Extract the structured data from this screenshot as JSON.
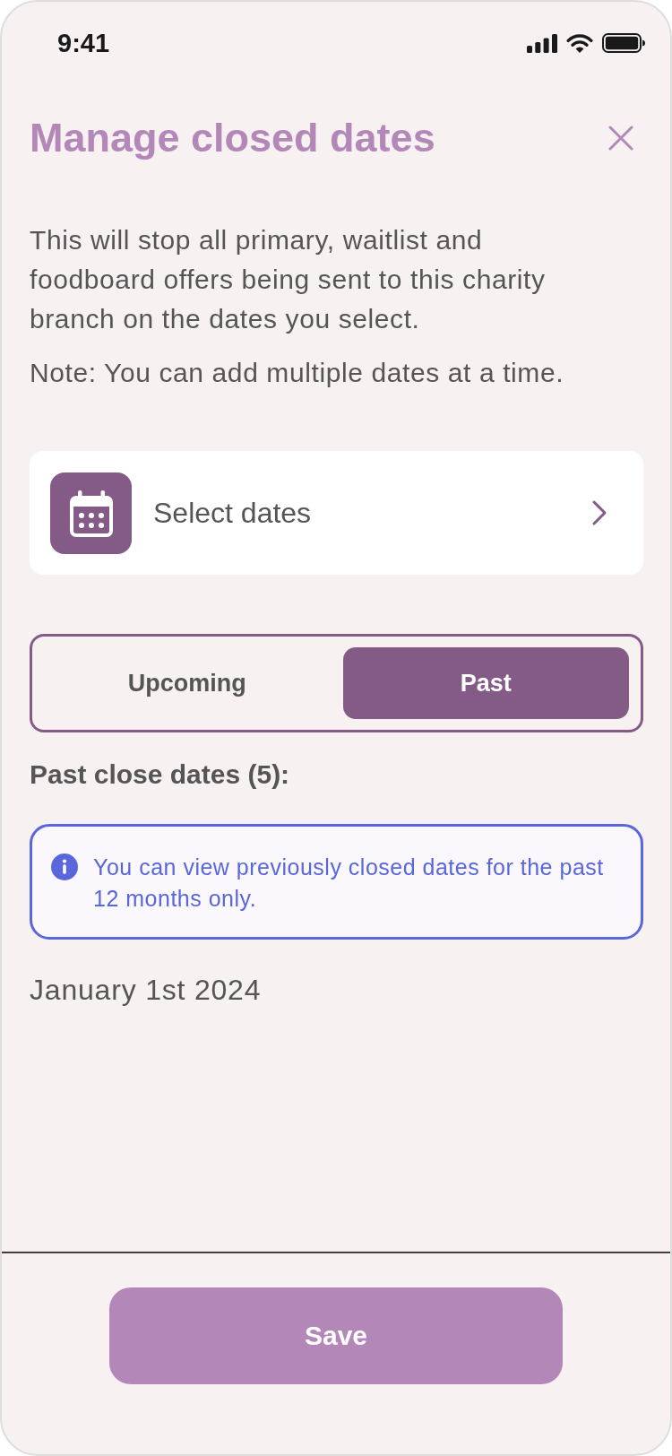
{
  "status_bar": {
    "time": "9:41"
  },
  "header": {
    "title": "Manage closed dates"
  },
  "description": [
    "This will stop all primary, waitlist and foodboard offers being sent to this charity branch on the dates you select.",
    "Note: You can add multiple dates at a time."
  ],
  "date_picker": {
    "label": "Select dates"
  },
  "segments": [
    {
      "label": "Upcoming",
      "selected": false
    },
    {
      "label": "Past",
      "selected": true
    }
  ],
  "section_title": "Past close dates (5):",
  "info_banner": {
    "text": "You can view previously closed dates for the past 12 months only."
  },
  "dates": [
    "January 1st 2024"
  ],
  "footer": {
    "save_button": "Save"
  }
}
